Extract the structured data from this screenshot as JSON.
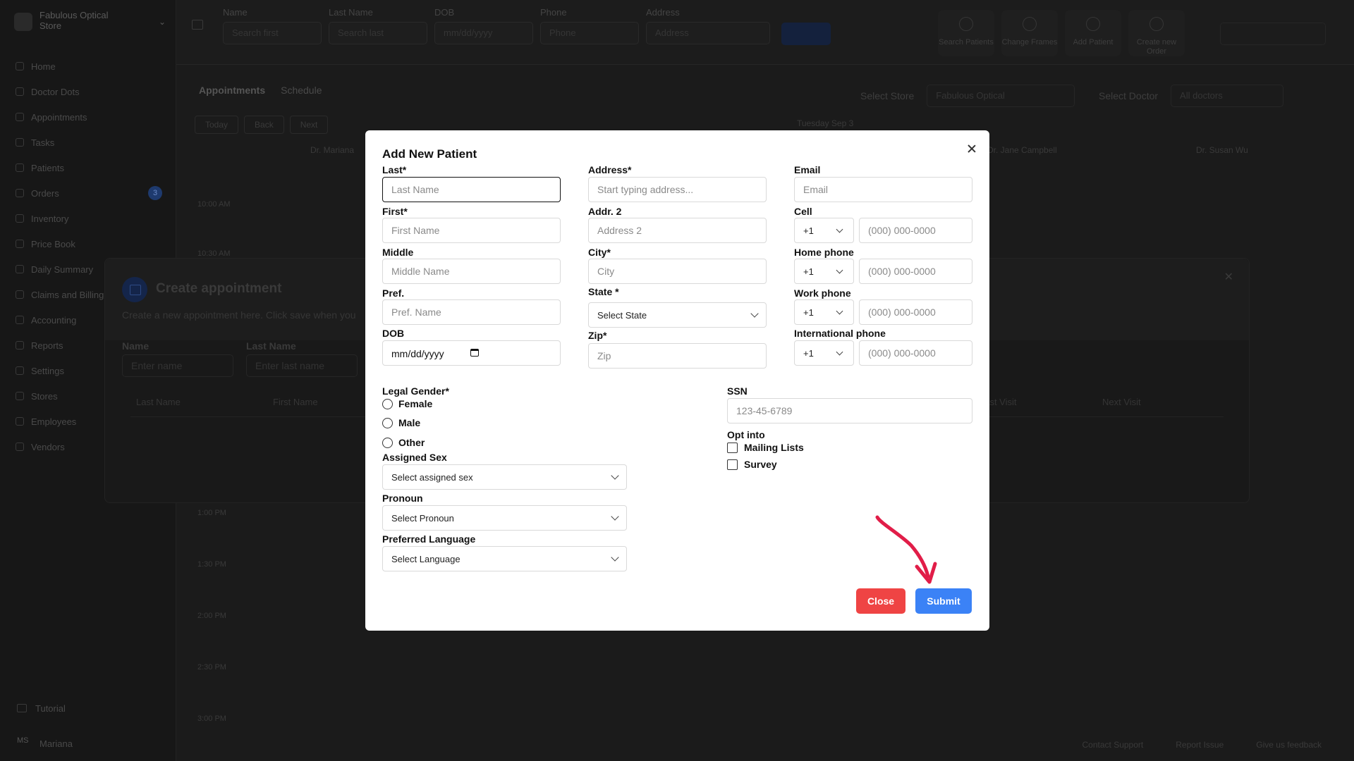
{
  "background": {
    "store": "Fabulous Optical",
    "store_sub": "Store",
    "nav": [
      "Home",
      "Doctor Dots",
      "Appointments",
      "Tasks",
      "Patients",
      "Orders",
      "Inventory",
      "Price Book",
      "Daily Summary",
      "Claims and Billing",
      "Accounting",
      "Reports",
      "Settings",
      "Stores",
      "Employees",
      "Vendors"
    ],
    "orders_badge": "3",
    "sidebar_bottom": {
      "tutorial": "Tutorial",
      "avatar": "MS",
      "user": "Mariana"
    },
    "filters": [
      {
        "label": "Name",
        "placeholder": "Search first"
      },
      {
        "label": "Last Name",
        "placeholder": "Search last"
      },
      {
        "label": "DOB",
        "placeholder": "mm/dd/yyyy"
      },
      {
        "label": "Phone",
        "placeholder": "Phone"
      },
      {
        "label": "Address",
        "placeholder": "Address"
      }
    ],
    "top_actions": [
      "Search Patients",
      "Change Frames",
      "Add Patient",
      "Create new Order"
    ],
    "tabs": {
      "active": "Appointments",
      "other": "Schedule"
    },
    "select_store": {
      "label": "Select Store",
      "value": "Fabulous Optical"
    },
    "select_doctor": {
      "label": "Select Doctor",
      "value": "All doctors"
    },
    "day_buttons": [
      "Today",
      "Back",
      "Next"
    ],
    "date_heading": "Tuesday Sep 3",
    "doctors": [
      "Dr. Mariana",
      "Dr. Jane Campbell",
      "Dr. Susan Wu"
    ],
    "times": [
      "10:00 AM",
      "10:30 AM",
      "1:00 PM",
      "1:30 PM",
      "2:00 PM",
      "2:30 PM",
      "3:00 PM"
    ],
    "footer_links": [
      "Contact Support",
      "Report Issue",
      "Give us feedback"
    ],
    "appointment_modal": {
      "title": "Create appointment",
      "subtitle": "Create a new appointment here. Click save when you",
      "name_label": "Name",
      "name_placeholder": "Enter name",
      "last_label": "Last Name",
      "last_placeholder": "Enter last name",
      "columns": [
        "Last Name",
        "First Name",
        "Last Visit",
        "Next Visit"
      ]
    }
  },
  "modal": {
    "title": "Add New Patient",
    "col1": {
      "last": {
        "label": "Last*",
        "placeholder": "Last Name"
      },
      "first": {
        "label": "First*",
        "placeholder": "First Name"
      },
      "middle": {
        "label": "Middle",
        "placeholder": "Middle Name"
      },
      "pref": {
        "label": "Pref.",
        "placeholder": "Pref. Name"
      },
      "dob": {
        "label": "DOB",
        "placeholder": "mm/dd/yyyy"
      }
    },
    "col2": {
      "address": {
        "label": "Address*",
        "placeholder": "Start typing address..."
      },
      "addr2": {
        "label": "Addr. 2",
        "placeholder": "Address 2"
      },
      "city": {
        "label": "City*",
        "placeholder": "City"
      },
      "state": {
        "label": "State *",
        "value": "Select State"
      },
      "zip": {
        "label": "Zip*",
        "placeholder": "Zip"
      }
    },
    "col3": {
      "email": {
        "label": "Email",
        "placeholder": "Email"
      },
      "cell": {
        "label": "Cell",
        "code": "+1",
        "placeholder": "(000) 000-0000"
      },
      "home": {
        "label": "Home phone",
        "code": "+1",
        "placeholder": "(000) 000-0000"
      },
      "work": {
        "label": "Work phone",
        "code": "+1",
        "placeholder": "(000) 000-0000"
      },
      "intl": {
        "label": "International phone",
        "code": "+1",
        "placeholder": "(000) 000-0000"
      }
    },
    "gender": {
      "label": "Legal Gender*",
      "options": [
        "Female",
        "Male",
        "Other"
      ]
    },
    "assigned_sex": {
      "label": "Assigned Sex",
      "value": "Select assigned sex"
    },
    "pronoun": {
      "label": "Pronoun",
      "value": "Select Pronoun"
    },
    "language": {
      "label": "Preferred Language",
      "value": "Select Language"
    },
    "ssn": {
      "label": "SSN",
      "placeholder": "123-45-6789"
    },
    "opt_into": {
      "label": "Opt into",
      "options": [
        "Mailing Lists",
        "Survey"
      ]
    },
    "buttons": {
      "close": "Close",
      "submit": "Submit"
    },
    "colors": {
      "submit": "#3b82f6",
      "close": "#ef4444",
      "annotation": "#e11d48"
    }
  }
}
